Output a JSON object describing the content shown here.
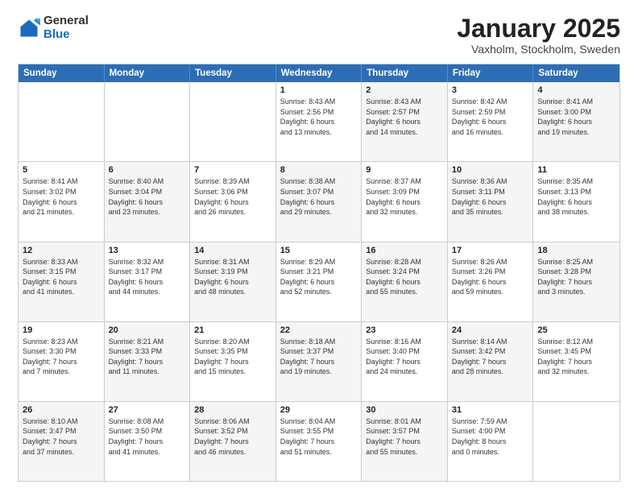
{
  "logo": {
    "general": "General",
    "blue": "Blue"
  },
  "header": {
    "month": "January 2025",
    "location": "Vaxholm, Stockholm, Sweden"
  },
  "weekdays": [
    "Sunday",
    "Monday",
    "Tuesday",
    "Wednesday",
    "Thursday",
    "Friday",
    "Saturday"
  ],
  "weeks": [
    [
      {
        "day": "",
        "info": "",
        "shaded": false,
        "empty": true
      },
      {
        "day": "",
        "info": "",
        "shaded": false,
        "empty": true
      },
      {
        "day": "",
        "info": "",
        "shaded": false,
        "empty": true
      },
      {
        "day": "1",
        "info": "Sunrise: 8:43 AM\nSunset: 2:56 PM\nDaylight: 6 hours\nand 13 minutes.",
        "shaded": false,
        "empty": false
      },
      {
        "day": "2",
        "info": "Sunrise: 8:43 AM\nSunset: 2:57 PM\nDaylight: 6 hours\nand 14 minutes.",
        "shaded": true,
        "empty": false
      },
      {
        "day": "3",
        "info": "Sunrise: 8:42 AM\nSunset: 2:59 PM\nDaylight: 6 hours\nand 16 minutes.",
        "shaded": false,
        "empty": false
      },
      {
        "day": "4",
        "info": "Sunrise: 8:41 AM\nSunset: 3:00 PM\nDaylight: 6 hours\nand 19 minutes.",
        "shaded": true,
        "empty": false
      }
    ],
    [
      {
        "day": "5",
        "info": "Sunrise: 8:41 AM\nSunset: 3:02 PM\nDaylight: 6 hours\nand 21 minutes.",
        "shaded": false,
        "empty": false
      },
      {
        "day": "6",
        "info": "Sunrise: 8:40 AM\nSunset: 3:04 PM\nDaylight: 6 hours\nand 23 minutes.",
        "shaded": true,
        "empty": false
      },
      {
        "day": "7",
        "info": "Sunrise: 8:39 AM\nSunset: 3:06 PM\nDaylight: 6 hours\nand 26 minutes.",
        "shaded": false,
        "empty": false
      },
      {
        "day": "8",
        "info": "Sunrise: 8:38 AM\nSunset: 3:07 PM\nDaylight: 6 hours\nand 29 minutes.",
        "shaded": true,
        "empty": false
      },
      {
        "day": "9",
        "info": "Sunrise: 8:37 AM\nSunset: 3:09 PM\nDaylight: 6 hours\nand 32 minutes.",
        "shaded": false,
        "empty": false
      },
      {
        "day": "10",
        "info": "Sunrise: 8:36 AM\nSunset: 3:11 PM\nDaylight: 6 hours\nand 35 minutes.",
        "shaded": true,
        "empty": false
      },
      {
        "day": "11",
        "info": "Sunrise: 8:35 AM\nSunset: 3:13 PM\nDaylight: 6 hours\nand 38 minutes.",
        "shaded": false,
        "empty": false
      }
    ],
    [
      {
        "day": "12",
        "info": "Sunrise: 8:33 AM\nSunset: 3:15 PM\nDaylight: 6 hours\nand 41 minutes.",
        "shaded": true,
        "empty": false
      },
      {
        "day": "13",
        "info": "Sunrise: 8:32 AM\nSunset: 3:17 PM\nDaylight: 6 hours\nand 44 minutes.",
        "shaded": false,
        "empty": false
      },
      {
        "day": "14",
        "info": "Sunrise: 8:31 AM\nSunset: 3:19 PM\nDaylight: 6 hours\nand 48 minutes.",
        "shaded": true,
        "empty": false
      },
      {
        "day": "15",
        "info": "Sunrise: 8:29 AM\nSunset: 3:21 PM\nDaylight: 6 hours\nand 52 minutes.",
        "shaded": false,
        "empty": false
      },
      {
        "day": "16",
        "info": "Sunrise: 8:28 AM\nSunset: 3:24 PM\nDaylight: 6 hours\nand 55 minutes.",
        "shaded": true,
        "empty": false
      },
      {
        "day": "17",
        "info": "Sunrise: 8:26 AM\nSunset: 3:26 PM\nDaylight: 6 hours\nand 59 minutes.",
        "shaded": false,
        "empty": false
      },
      {
        "day": "18",
        "info": "Sunrise: 8:25 AM\nSunset: 3:28 PM\nDaylight: 7 hours\nand 3 minutes.",
        "shaded": true,
        "empty": false
      }
    ],
    [
      {
        "day": "19",
        "info": "Sunrise: 8:23 AM\nSunset: 3:30 PM\nDaylight: 7 hours\nand 7 minutes.",
        "shaded": false,
        "empty": false
      },
      {
        "day": "20",
        "info": "Sunrise: 8:21 AM\nSunset: 3:33 PM\nDaylight: 7 hours\nand 11 minutes.",
        "shaded": true,
        "empty": false
      },
      {
        "day": "21",
        "info": "Sunrise: 8:20 AM\nSunset: 3:35 PM\nDaylight: 7 hours\nand 15 minutes.",
        "shaded": false,
        "empty": false
      },
      {
        "day": "22",
        "info": "Sunrise: 8:18 AM\nSunset: 3:37 PM\nDaylight: 7 hours\nand 19 minutes.",
        "shaded": true,
        "empty": false
      },
      {
        "day": "23",
        "info": "Sunrise: 8:16 AM\nSunset: 3:40 PM\nDaylight: 7 hours\nand 24 minutes.",
        "shaded": false,
        "empty": false
      },
      {
        "day": "24",
        "info": "Sunrise: 8:14 AM\nSunset: 3:42 PM\nDaylight: 7 hours\nand 28 minutes.",
        "shaded": true,
        "empty": false
      },
      {
        "day": "25",
        "info": "Sunrise: 8:12 AM\nSunset: 3:45 PM\nDaylight: 7 hours\nand 32 minutes.",
        "shaded": false,
        "empty": false
      }
    ],
    [
      {
        "day": "26",
        "info": "Sunrise: 8:10 AM\nSunset: 3:47 PM\nDaylight: 7 hours\nand 37 minutes.",
        "shaded": true,
        "empty": false
      },
      {
        "day": "27",
        "info": "Sunrise: 8:08 AM\nSunset: 3:50 PM\nDaylight: 7 hours\nand 41 minutes.",
        "shaded": false,
        "empty": false
      },
      {
        "day": "28",
        "info": "Sunrise: 8:06 AM\nSunset: 3:52 PM\nDaylight: 7 hours\nand 46 minutes.",
        "shaded": true,
        "empty": false
      },
      {
        "day": "29",
        "info": "Sunrise: 8:04 AM\nSunset: 3:55 PM\nDaylight: 7 hours\nand 51 minutes.",
        "shaded": false,
        "empty": false
      },
      {
        "day": "30",
        "info": "Sunrise: 8:01 AM\nSunset: 3:57 PM\nDaylight: 7 hours\nand 55 minutes.",
        "shaded": true,
        "empty": false
      },
      {
        "day": "31",
        "info": "Sunrise: 7:59 AM\nSunset: 4:00 PM\nDaylight: 8 hours\nand 0 minutes.",
        "shaded": false,
        "empty": false
      },
      {
        "day": "",
        "info": "",
        "shaded": true,
        "empty": true
      }
    ]
  ]
}
